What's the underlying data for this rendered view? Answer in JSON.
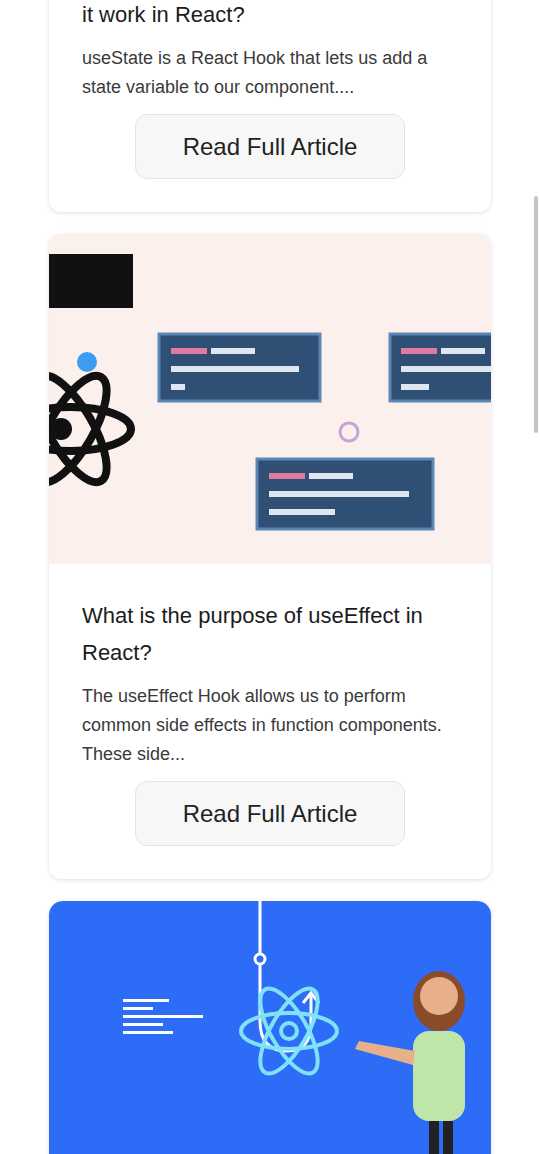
{
  "articles": [
    {
      "kind": "text",
      "title": "it work in React?",
      "excerpt": "useState is a React Hook that lets us add a state variable to our component....",
      "button": "Read Full Article"
    },
    {
      "kind": "light",
      "title": "What is the purpose of useEffect in React?",
      "excerpt": "The useEffect Hook allows us to perform common side effects in function components. These side...",
      "button": "Read Full Article"
    },
    {
      "kind": "blue"
    }
  ],
  "scrollbar": {
    "level": 0.17
  }
}
